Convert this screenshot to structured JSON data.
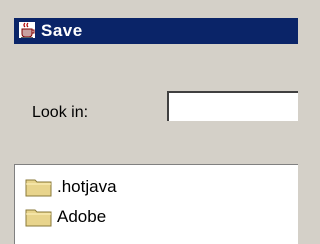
{
  "window": {
    "title": "Save",
    "title_bar_color": "#0a2468",
    "background_color": "#d4d0c8",
    "app_icon": "java-cup-icon"
  },
  "look_in": {
    "label": "Look in:",
    "value": ""
  },
  "file_list": {
    "items": [
      {
        "name": ".hotjava",
        "icon": "folder-icon"
      },
      {
        "name": "Adobe",
        "icon": "folder-icon"
      }
    ],
    "folder_color": "#e8d48c"
  }
}
